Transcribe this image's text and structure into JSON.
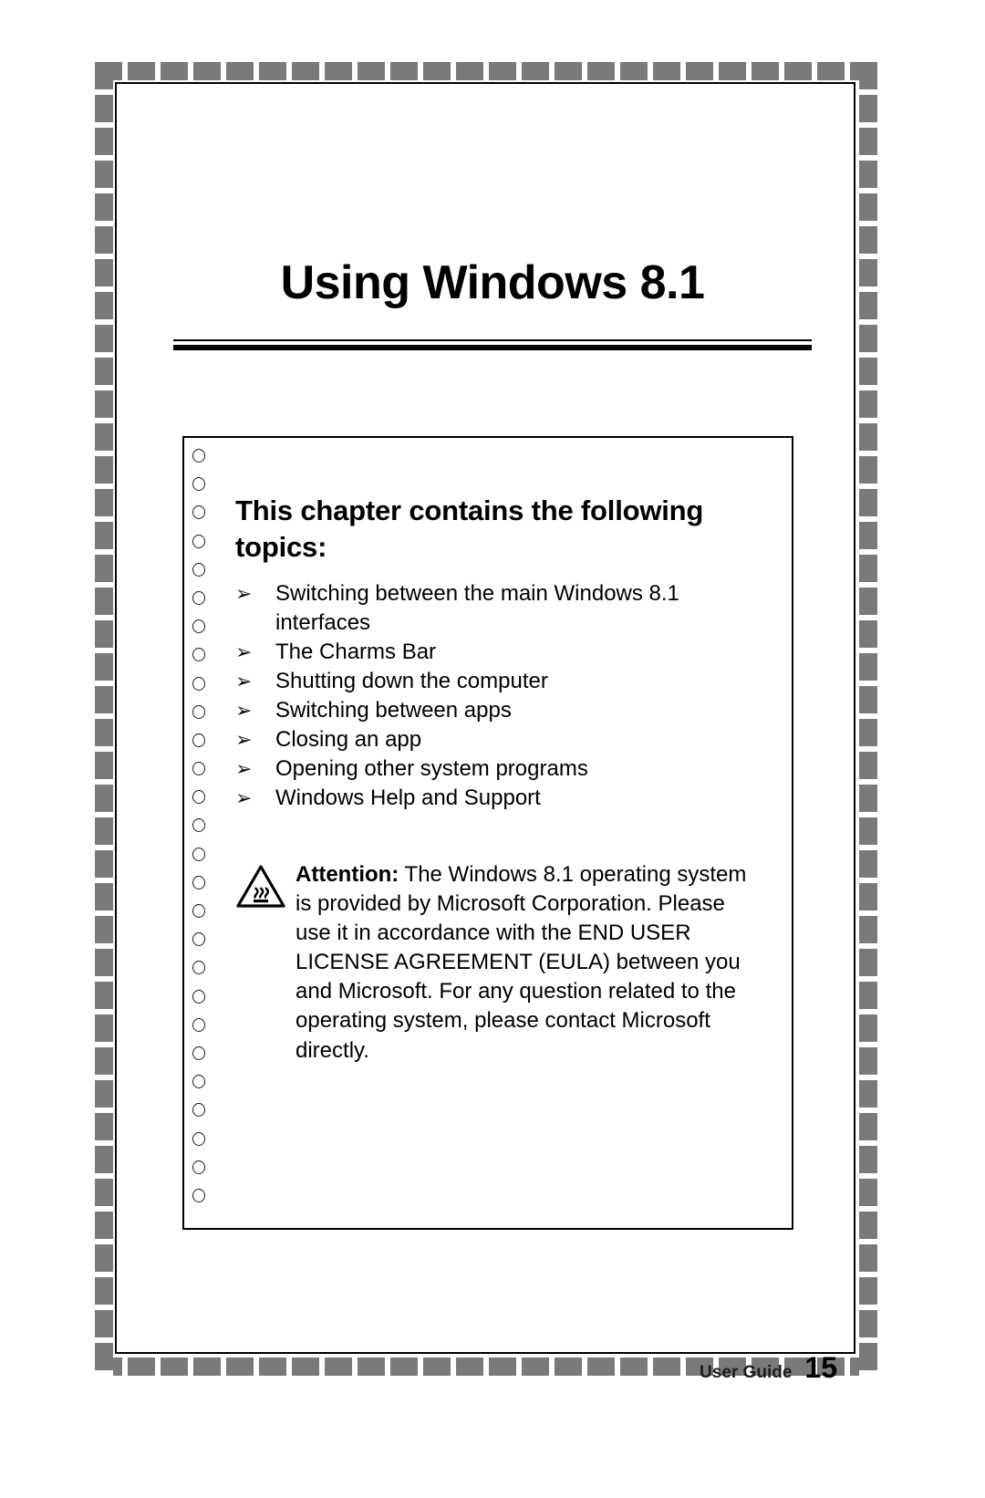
{
  "document": {
    "chapter_title": "Using Windows 8.1"
  },
  "content_box": {
    "heading": "This chapter contains the following topics:",
    "bullet_marker": "➢",
    "topics": [
      "Switching between the main Windows 8.1 interfaces",
      "The Charms Bar",
      "Shutting down the computer",
      "Switching between apps",
      "Closing an app",
      "Opening other system programs",
      "Windows Help and Support"
    ],
    "attention": {
      "icon": "warning-hot-surface-triangle-icon",
      "label": "Attention:",
      "text": " The Windows 8.1 operating system is provided by Microsoft Corporation. Please use it in accordance with the END USER LICENSE AGREEMENT (EULA) between you and Microsoft. For any question related to the operating system, please contact Microsoft directly."
    }
  },
  "footer": {
    "label": "User Guide",
    "page_number": "15"
  },
  "colors": {
    "border_gray": "#7a7a7a",
    "ink": "#000000",
    "paper": "#ffffff"
  }
}
